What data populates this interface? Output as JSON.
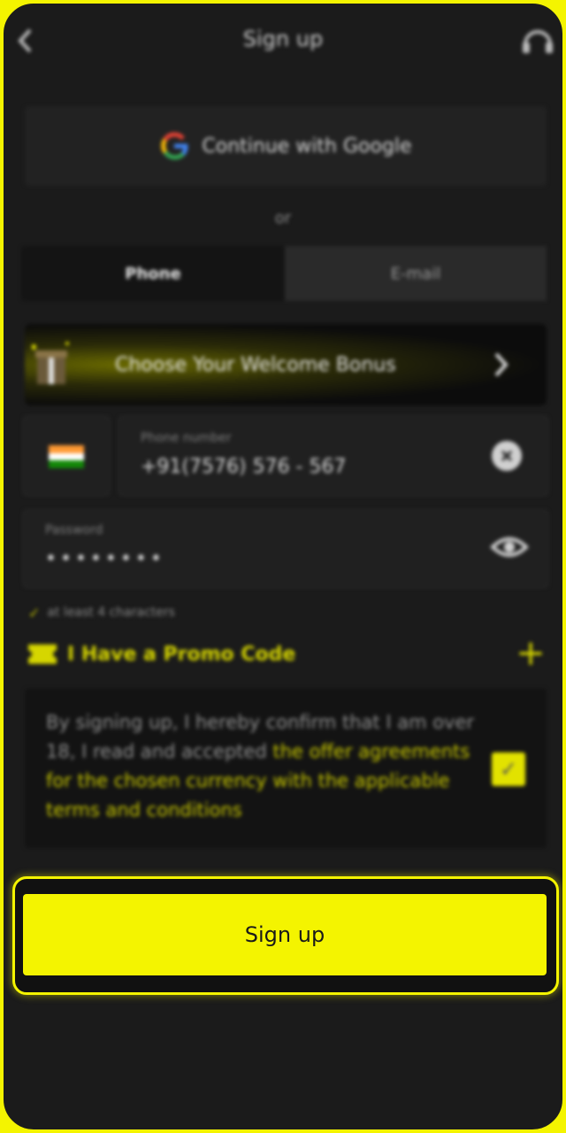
{
  "header": {
    "title": "Sign up",
    "back_icon": "chevron-left-icon",
    "support_icon": "headset-icon"
  },
  "google": {
    "label": "Continue with Google"
  },
  "divider": {
    "label": "or"
  },
  "tabs": [
    {
      "label": "Phone",
      "active": true
    },
    {
      "label": "E-mail",
      "active": false
    }
  ],
  "bonus": {
    "label": "Choose Your Welcome Bonus"
  },
  "phone_field": {
    "label": "Phone number",
    "value": "+91(7576) 576 - 567"
  },
  "password_field": {
    "label": "Password",
    "value": "••••••••"
  },
  "hint": {
    "label": "at least 4 characters"
  },
  "promo": {
    "label": "I Have a Promo Code"
  },
  "agreement": {
    "text": "By signing up, I hereby confirm that I am over 18, I read and accepted ",
    "link": "the offer agreements for the chosen currency with the applicable terms and conditions",
    "checked": true
  },
  "submit": {
    "label": "Sign up"
  },
  "colors": {
    "accent": "#f4f400",
    "background": "#1b1b1b"
  }
}
